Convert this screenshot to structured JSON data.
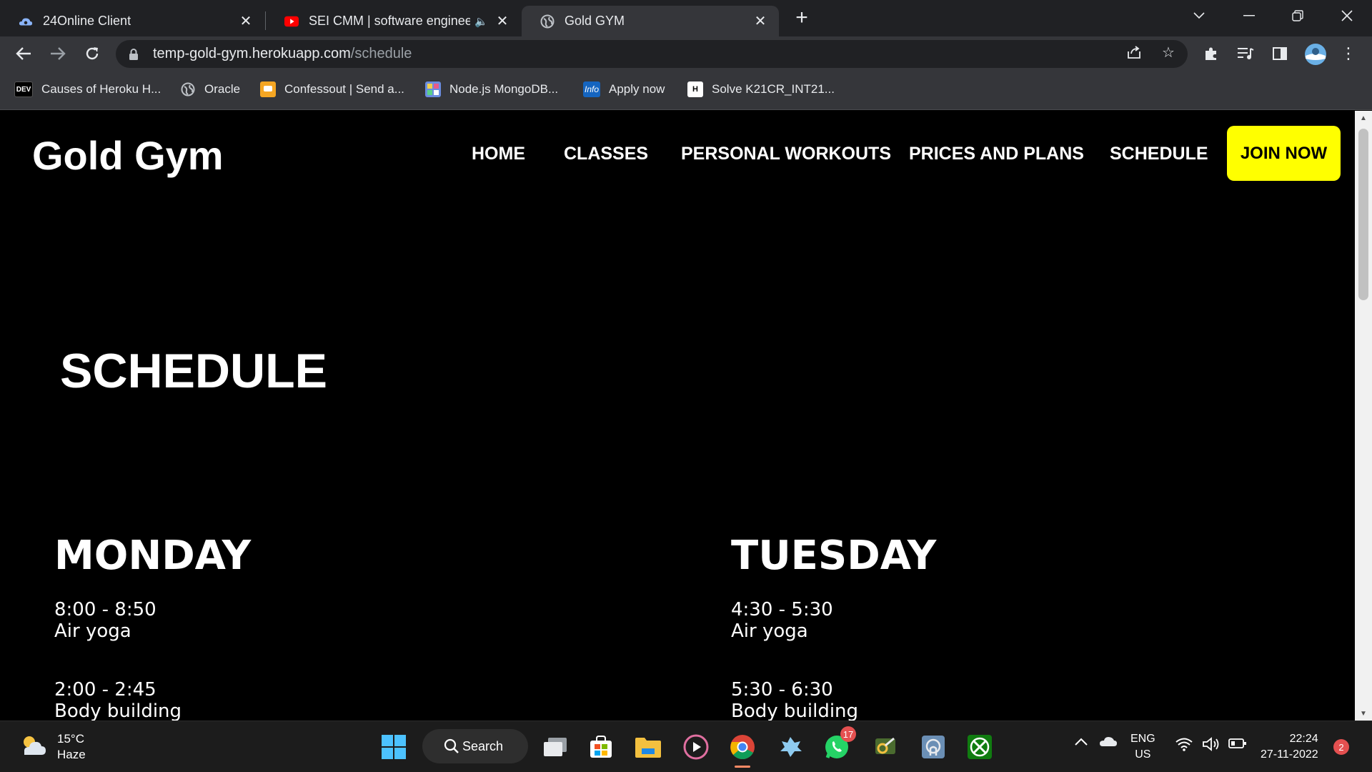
{
  "browser": {
    "tabs": [
      {
        "title": "24Online Client",
        "icon": "cloud-icon"
      },
      {
        "title": "SEI CMM | software engineer",
        "icon": "youtube-icon",
        "audio": "🔈"
      },
      {
        "title": "Gold GYM",
        "icon": "globe-icon"
      }
    ],
    "new_tab": "+",
    "address": {
      "host": "temp-gold-gym.herokuapp.com",
      "path": "/schedule"
    },
    "bookmarks": [
      {
        "label": "Causes of Heroku H...",
        "icon_text": "DEV"
      },
      {
        "label": "Oracle",
        "icon_text": ""
      },
      {
        "label": "Confessout | Send a...",
        "icon_text": ""
      },
      {
        "label": "Node.js MongoDB...",
        "icon_text": ""
      },
      {
        "label": "Apply now",
        "icon_text": "Info"
      },
      {
        "label": "Solve K21CR_INT21...",
        "icon_text": "H"
      }
    ]
  },
  "site": {
    "brand": "Gold Gym",
    "nav": [
      "HOME",
      "CLASSES",
      "PERSONAL WORKOUTS",
      "PRICES AND PLANS",
      "SCHEDULE"
    ],
    "cta": "JOIN NOW",
    "accent_color": "#ffff00"
  },
  "schedule": {
    "title": "SCHEDULE",
    "days": [
      {
        "name": "MONDAY",
        "sessions": [
          {
            "time": "8:00 - 8:50",
            "class": "Air yoga"
          },
          {
            "time": "2:00 - 2:45",
            "class": "Body building"
          }
        ]
      },
      {
        "name": "TUESDAY",
        "sessions": [
          {
            "time": "4:30 - 5:30",
            "class": "Air yoga"
          },
          {
            "time": "5:30 - 6:30",
            "class": "Body building"
          }
        ]
      }
    ]
  },
  "taskbar": {
    "weather": {
      "temp": "15°C",
      "condition": "Haze"
    },
    "search_label": "Search",
    "whatsapp_badge": "17",
    "lang": {
      "line1": "ENG",
      "line2": "US"
    },
    "clock": {
      "time": "22:24",
      "date": "27-11-2022"
    },
    "notification_count": "2"
  }
}
